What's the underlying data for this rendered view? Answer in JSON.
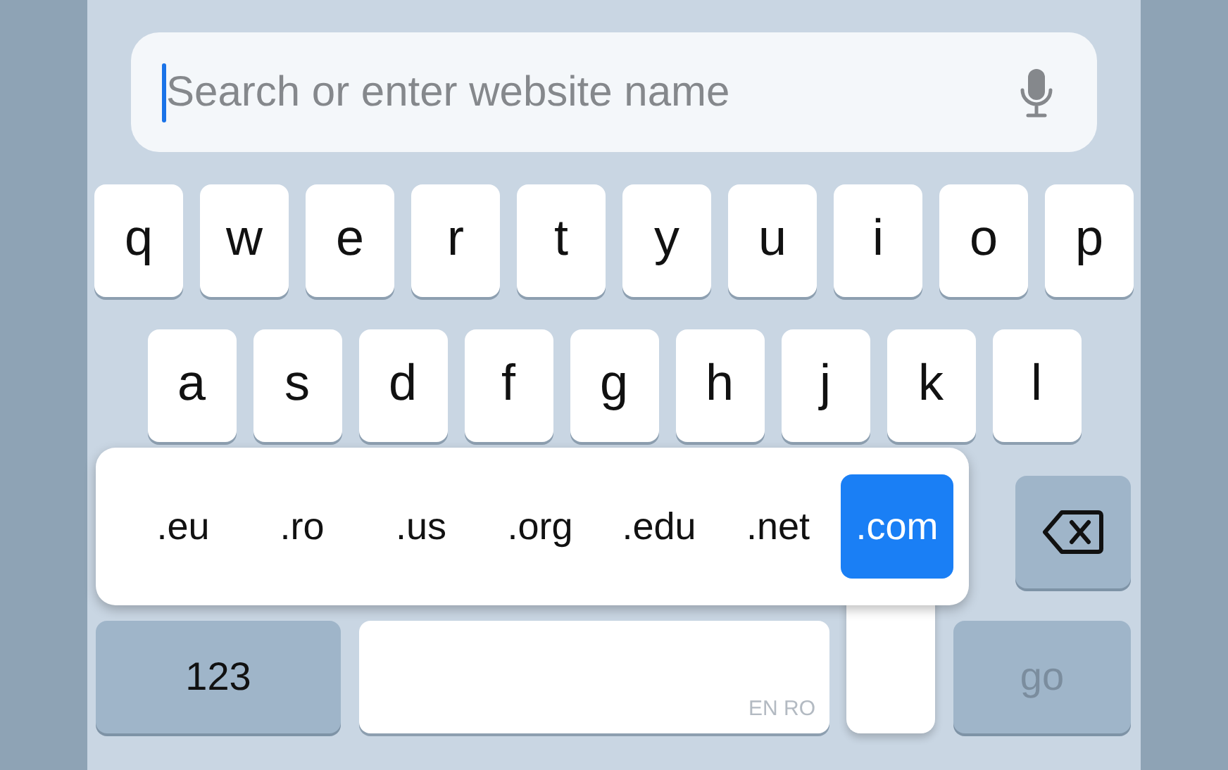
{
  "search": {
    "placeholder": "Search or enter website name",
    "focused": true
  },
  "key_rows": [
    [
      "q",
      "w",
      "e",
      "r",
      "t",
      "y",
      "u",
      "i",
      "o",
      "p"
    ],
    [
      "a",
      "s",
      "d",
      "f",
      "g",
      "h",
      "j",
      "k",
      "l"
    ]
  ],
  "domain_popup": {
    "options": [
      {
        "label": ".eu",
        "selected": false
      },
      {
        "label": ".ro",
        "selected": false
      },
      {
        "label": ".us",
        "selected": false
      },
      {
        "label": ".org",
        "selected": false
      },
      {
        "label": ".edu",
        "selected": false
      },
      {
        "label": ".net",
        "selected": false
      },
      {
        "label": ".com",
        "selected": true
      }
    ]
  },
  "bottom_row": {
    "numbers_key": "123",
    "space_languages": "EN RO",
    "go_key": "go",
    "go_enabled": false
  }
}
